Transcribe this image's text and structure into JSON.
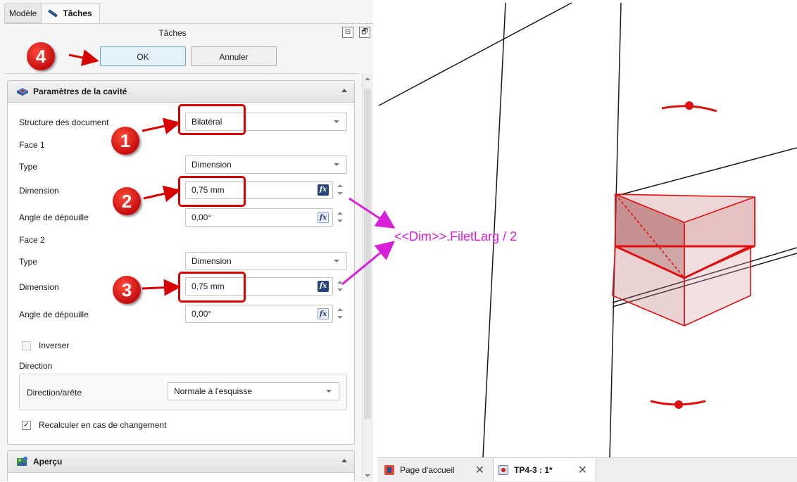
{
  "tabs": {
    "model": "Modèle",
    "tasks": "Tâches"
  },
  "panel": {
    "title": "Tâches",
    "ok_label": "OK",
    "cancel_label": "Annuler"
  },
  "pocket": {
    "section_title": "Paramètres de la cavité",
    "structure_label": "Structure des document",
    "structure_value": "Bilatéral",
    "face1_label": "Face 1",
    "face1_type_label": "Type",
    "face1_type_value": "Dimension",
    "face1_dim_label": "Dimension",
    "face1_dim_value": "0,75 mm",
    "face1_angle_label": "Angle de dépouille",
    "face1_angle_value": "0,00°",
    "face2_label": "Face 2",
    "face2_type_label": "Type",
    "face2_type_value": "Dimension",
    "face2_dim_label": "Dimension",
    "face2_dim_value": "0,75 mm",
    "face2_angle_label": "Angle de dépouille",
    "face2_angle_value": "0,00°",
    "reverse_label": "Inverser",
    "reverse_checked": false,
    "direction_group": "Direction",
    "direction_edge_label": "Direction/arête",
    "direction_edge_value": "Normale à l'esquisse",
    "recompute_label": "Recalculer en cas de changement",
    "recompute_checked": true,
    "check_mark": "✓",
    "fx": "fx"
  },
  "preview": {
    "section_title": "Aperçu"
  },
  "annotations": {
    "badge1": "1",
    "badge2": "2",
    "badge3": "3",
    "badge4": "4",
    "formula": "<<Dim>>.FiletLarg / 2",
    "highlight_color": "#d90000",
    "formula_color": "#d81fd8"
  },
  "doc_tabs": {
    "start_page": "Page d'accueil",
    "document": "TP4-3 : 1*",
    "close": "✕"
  },
  "window_buttons": {
    "dock": "⊟",
    "float": "🗗"
  }
}
